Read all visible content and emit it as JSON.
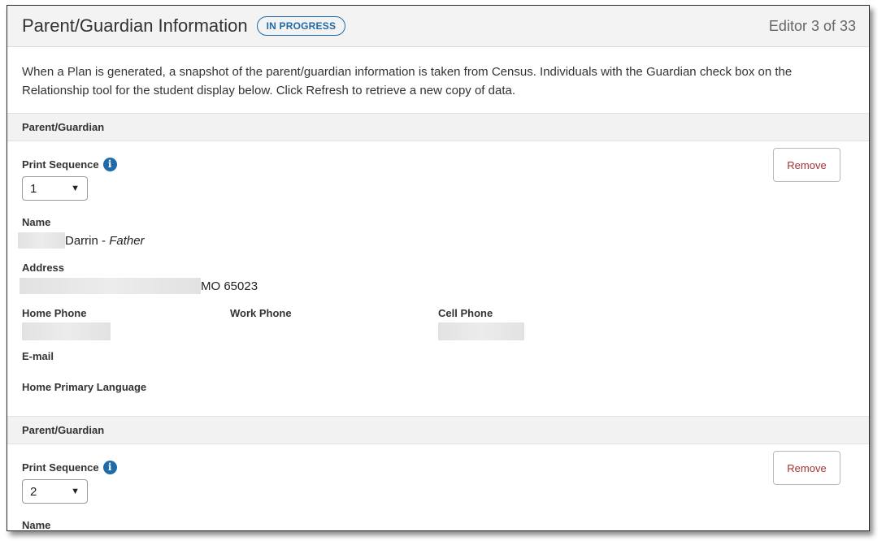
{
  "header": {
    "title": "Parent/Guardian Information",
    "status": "IN PROGRESS",
    "editor_count": "Editor 3 of 33"
  },
  "description": "When a Plan is generated, a snapshot of the parent/guardian information is taken from Census. Individuals with the Guardian check box on the Relationship tool for the student display below. Click Refresh to retrieve a new copy of data.",
  "guardians": [
    {
      "section_title": "Parent/Guardian",
      "print_sequence_label": "Print Sequence",
      "print_sequence_value": "1",
      "remove_label": "Remove",
      "name_label": "Name",
      "first_name": "Darrin",
      "name_separator": " - ",
      "relationship": "Father",
      "address_label": "Address",
      "address_suffix": "MO 65023",
      "home_phone_label": "Home Phone",
      "work_phone_label": "Work Phone",
      "cell_phone_label": "Cell Phone",
      "email_label": "E-mail",
      "language_label": "Home Primary Language"
    },
    {
      "section_title": "Parent/Guardian",
      "print_sequence_label": "Print Sequence",
      "print_sequence_value": "2",
      "remove_label": "Remove",
      "name_label": "Name"
    }
  ],
  "icons": {
    "info": "info-icon",
    "dropdown": "chevron-down-icon"
  },
  "colors": {
    "accent": "#1f6aa8",
    "remove_text": "#a33333",
    "header_bg": "#f3f3f3"
  }
}
